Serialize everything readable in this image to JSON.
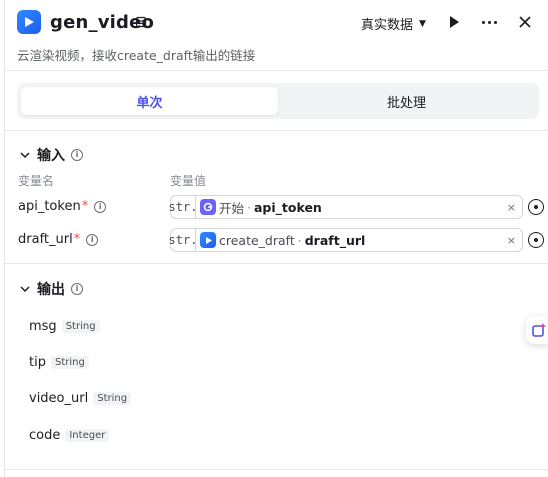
{
  "header": {
    "title": "gen_video",
    "data_select_label": "真实数据",
    "icon_names": [
      "video-app-icon",
      "edit-icon",
      "caret-down-icon",
      "play-icon",
      "more-icon",
      "close-icon"
    ]
  },
  "description": "云渲染视频，接收create_draft输出的链接",
  "tabs": [
    {
      "label": "单次",
      "active": true
    },
    {
      "label": "批处理",
      "active": false
    }
  ],
  "input_section": {
    "title": "输入",
    "col_name": "变量名",
    "col_value": "变量值",
    "params": [
      {
        "name": "api_token",
        "required_mark": "*",
        "type": "str.",
        "node": "开始",
        "sep": " · ",
        "var": "api_token",
        "clear": "×"
      },
      {
        "name": "draft_url",
        "required_mark": "*",
        "type": "str.",
        "node": "create_draft",
        "sep": " · ",
        "var": "draft_url",
        "clear": "×"
      }
    ]
  },
  "output_section": {
    "title": "输出",
    "items": [
      {
        "name": "msg",
        "type": "String"
      },
      {
        "name": "tip",
        "type": "String"
      },
      {
        "name": "video_url",
        "type": "String"
      },
      {
        "name": "code",
        "type": "Integer"
      }
    ]
  },
  "colors": {
    "accent": "#4d53e8",
    "required": "#f54a45",
    "start_node": "#6b63f5",
    "video_node": "#1d5cf0"
  }
}
